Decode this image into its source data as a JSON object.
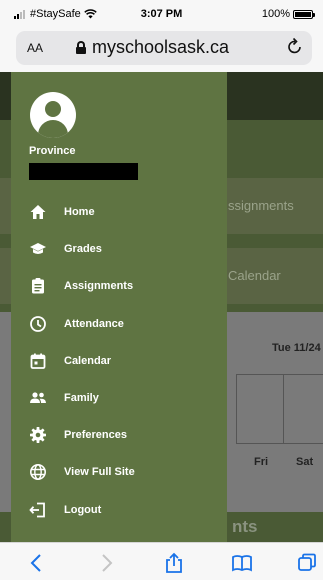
{
  "status_bar": {
    "carrier": "#StaySafe",
    "time": "3:07 PM",
    "battery": "100%"
  },
  "browser": {
    "text_size_label": "AA",
    "url": "myschoolsask.ca"
  },
  "background_page": {
    "card_assignments": "ssignments",
    "card_calendar": "Calendar",
    "calendar_date": "Tue 11/24",
    "day_fri": "Fri",
    "day_sat": "Sat",
    "footer_text": "nts"
  },
  "drawer": {
    "profile_label": "Province",
    "menu": [
      {
        "label": "Home",
        "icon": "home-icon"
      },
      {
        "label": "Grades",
        "icon": "graduation-cap-icon"
      },
      {
        "label": "Assignments",
        "icon": "clipboard-icon"
      },
      {
        "label": "Attendance",
        "icon": "clock-icon"
      },
      {
        "label": "Calendar",
        "icon": "calendar-icon"
      },
      {
        "label": "Family",
        "icon": "family-icon"
      },
      {
        "label": "Preferences",
        "icon": "gear-icon"
      },
      {
        "label": "View Full Site",
        "icon": "globe-icon"
      },
      {
        "label": "Logout",
        "icon": "logout-icon"
      }
    ]
  },
  "toolbar": {
    "icons": [
      "back-icon",
      "forward-icon",
      "share-icon",
      "bookmarks-icon",
      "tabs-icon"
    ]
  },
  "colors": {
    "drawer_background": "#5f7442",
    "browser_link": "#1a73e8"
  }
}
